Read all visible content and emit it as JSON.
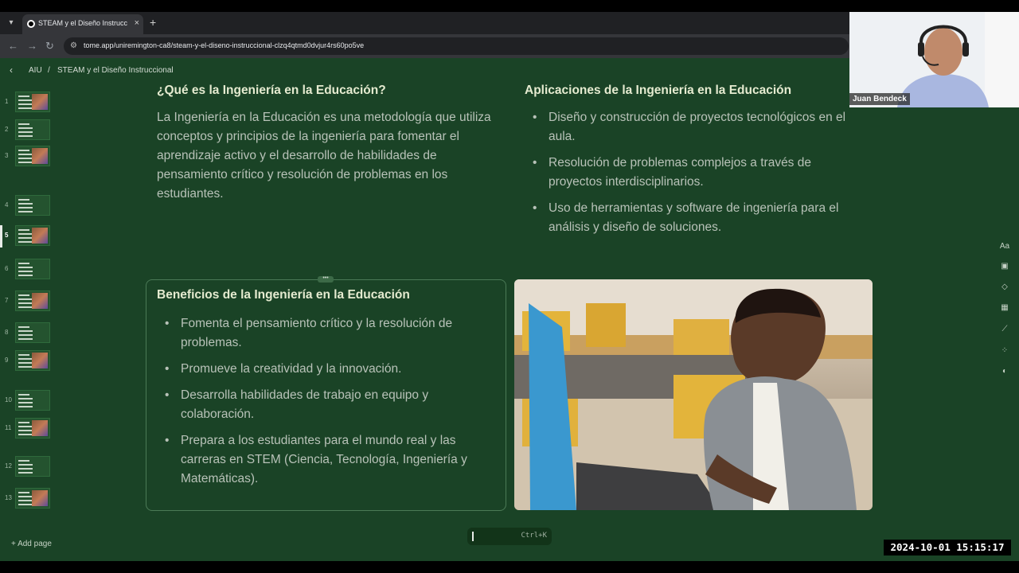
{
  "browser": {
    "tab_title": "STEAM y el Diseño Instruccional",
    "url": "tome.app/uniremington-ca8/steam-y-el-diseno-instruccional-clzq4qtmd0dvjur4rs60po5ve"
  },
  "breadcrumb": {
    "workspace": "AIU",
    "separator": "/",
    "page": "STEAM y el Diseño Instruccional"
  },
  "thumbnails": [
    "1",
    "2",
    "3",
    "4",
    "5",
    "6",
    "7",
    "8",
    "9",
    "10",
    "11",
    "12",
    "13"
  ],
  "active_page": "5",
  "add_page_label": "+ Add page",
  "section_what": {
    "heading": "¿Qué es la Ingeniería en la Educación?",
    "body": "La Ingeniería en la Educación es una metodología que utiliza conceptos y principios de la ingeniería para fomentar el aprendizaje activo y el desarrollo de habilidades de pensamiento crítico y resolución de problemas en los estudiantes."
  },
  "section_apps": {
    "heading": "Aplicaciones de la Ingeniería en la Educación",
    "items": [
      "Diseño y construcción de proyectos tecnológicos en el aula.",
      "Resolución de problemas complejos a través de proyectos interdisciplinarios.",
      "Uso de herramientas y software de ingeniería para el análisis y diseño de soluciones."
    ]
  },
  "section_benefits": {
    "heading": "Beneficios de la Ingeniería en la Educación",
    "items": [
      "Fomenta el pensamiento crítico y la resolución de problemas.",
      "Promueve la creatividad y la innovación.",
      "Desarrolla habilidades de trabajo en equipo y colaboración.",
      "Prepara a los estudiantes para el mundo real y las carreras en STEM (Ciencia, Tecnología, Ingeniería y Matemáticas)."
    ]
  },
  "tools": [
    "Aa",
    "image-icon",
    "shapes-icon",
    "table-icon",
    "chart-icon",
    "apps-icon",
    "palette-icon"
  ],
  "command_bar": {
    "shortcut": "Ctrl+K"
  },
  "webcam": {
    "name": "Juan Bendeck"
  },
  "timestamp": "2024-10-01  15:15:17"
}
